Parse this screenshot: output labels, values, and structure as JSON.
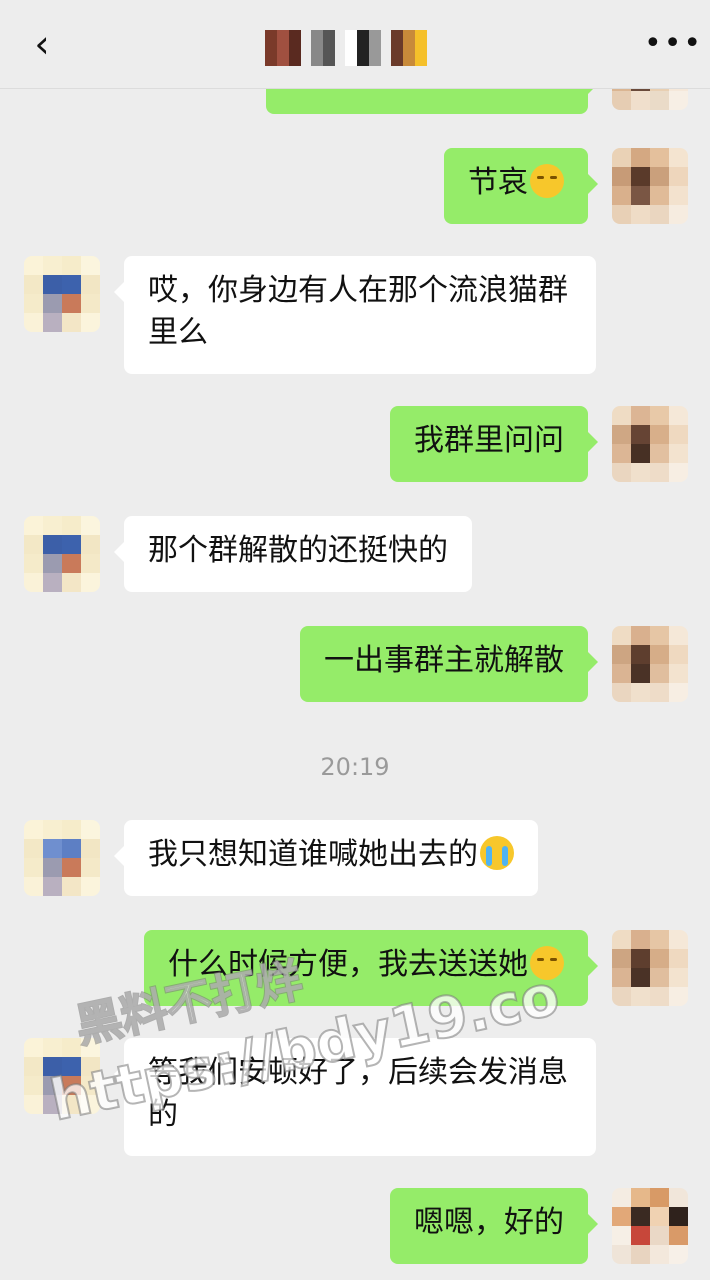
{
  "header": {
    "back_icon": "chevron-left-icon",
    "back_glyph": "‹",
    "title": "",
    "more_icon": "more-dots-icon",
    "more_glyph": "•••"
  },
  "messages": [
    {
      "side": "out",
      "text": ""
    },
    {
      "side": "out",
      "text": "节哀",
      "emoji": "pensive"
    },
    {
      "side": "in",
      "text": "哎，你身边有人在那个流浪猫群里么"
    },
    {
      "side": "out",
      "text": "我群里问问"
    },
    {
      "side": "in",
      "text": "那个群解散的还挺快的"
    },
    {
      "side": "out",
      "text": "一出事群主就解散"
    },
    {
      "side": "in",
      "text": "我只想知道谁喊她出去的",
      "emoji": "crying"
    },
    {
      "side": "out",
      "text": "什么时候方便，我去送送她",
      "emoji": "pensive"
    },
    {
      "side": "in",
      "text": "等我们安顿好了，后续会发消息的"
    },
    {
      "side": "out",
      "text": "嗯嗯，好的"
    }
  ],
  "timestamp": "20:19",
  "watermark": {
    "line1": "黑料不打烊",
    "line2": "https://bdy19.co"
  },
  "colors": {
    "bg": "#ededed",
    "outgoing": "#95ec69",
    "incoming": "#ffffff"
  }
}
